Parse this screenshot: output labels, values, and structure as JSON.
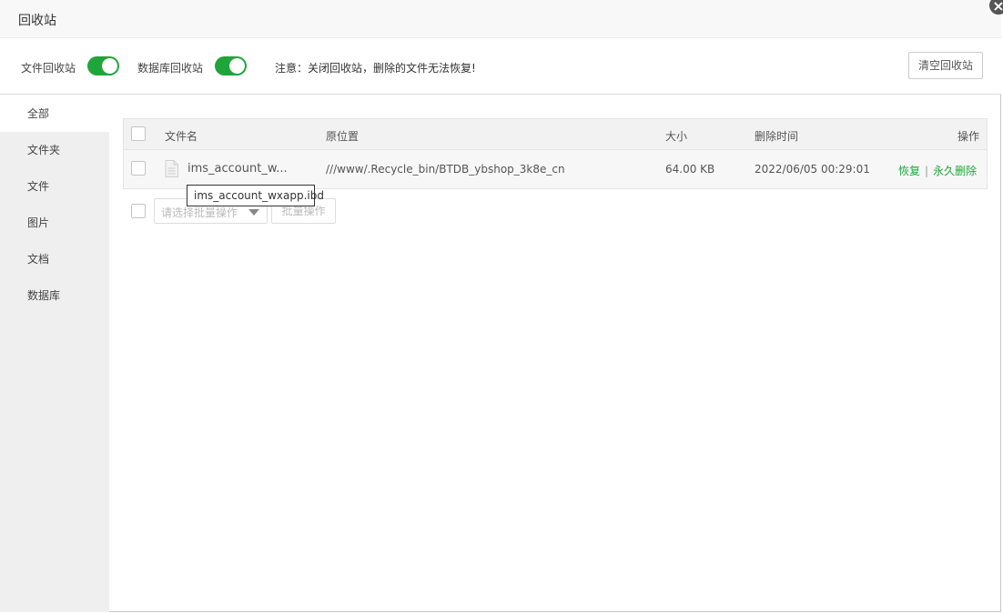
{
  "window": {
    "title": "回收站",
    "close_glyph": "×"
  },
  "settings": {
    "file_recycle_label": "文件回收站",
    "file_recycle_on": true,
    "db_recycle_label": "数据库回收站",
    "db_recycle_on": true,
    "notice": "注意：关闭回收站，删除的文件无法恢复!",
    "clear_button": "清空回收站"
  },
  "sidebar": {
    "items": [
      {
        "label": "全部",
        "active": true
      },
      {
        "label": "文件夹"
      },
      {
        "label": "文件"
      },
      {
        "label": "图片"
      },
      {
        "label": "文档"
      },
      {
        "label": "数据库"
      }
    ]
  },
  "table": {
    "columns": {
      "name": "文件名",
      "location": "原位置",
      "size": "大小",
      "time": "删除时间",
      "ops": "操作"
    },
    "rows": [
      {
        "name": "ims_account_w...",
        "location": "///www/.Recycle_bin/BTDB_ybshop_3k8e_cn",
        "size": "64.00 KB",
        "time": "2022/06/05 00:29:01",
        "restore": "恢复",
        "separator": "|",
        "delete": "永久删除"
      }
    ]
  },
  "tooltip": {
    "text": "ims_account_wxapp.ibd"
  },
  "batch": {
    "select_placeholder": "请选择批量操作",
    "button": "批量操作"
  },
  "colors": {
    "accent": "#20a53a",
    "sidebar_bg": "#efefef"
  },
  "icons": {
    "close": "close-icon",
    "file": "file-icon",
    "caret": "caret-down-icon"
  }
}
